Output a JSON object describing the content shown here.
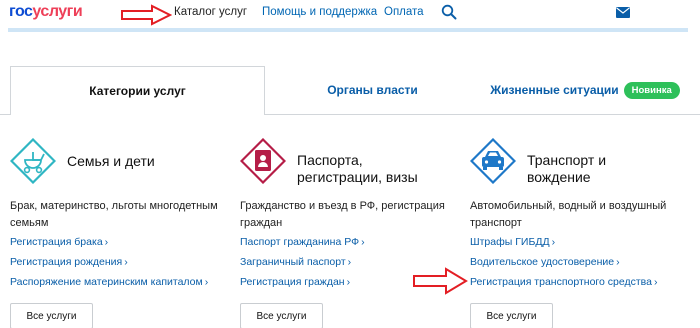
{
  "header": {
    "logo_part1": "гос",
    "logo_part2": "услуги",
    "nav": [
      {
        "label": "Каталог услуг"
      },
      {
        "label": "Помощь и поддержка"
      },
      {
        "label": "Оплата"
      }
    ],
    "icons": {
      "search": "search-icon",
      "mail": "mail-icon"
    }
  },
  "tabs": [
    {
      "label": "Категории услуг"
    },
    {
      "label": "Органы власти"
    },
    {
      "label": "Жизненные ситуации",
      "badge": "Новинка"
    }
  ],
  "categories": [
    {
      "title_line1": "Семья и дети",
      "title_line2": "",
      "description": "Брак, материнство, льготы многодетным семьям",
      "links": [
        "Регистрация брака",
        "Регистрация рождения",
        "Распоряжение материнским капиталом"
      ],
      "button": "Все услуги",
      "icon": "stroller-icon"
    },
    {
      "title_line1": "Паспорта,",
      "title_line2": "регистрации, визы",
      "description": "Гражданство и въезд в РФ, регистрация граждан",
      "links": [
        "Паспорт гражданина РФ",
        "Заграничный паспорт",
        "Регистрация граждан"
      ],
      "button": "Все услуги",
      "icon": "passport-icon"
    },
    {
      "title_line1": "Транспорт и",
      "title_line2": "вождение",
      "description": "Автомобильный, водный и воздушный транспорт",
      "links": [
        "Штрафы ГИБДД",
        "Водительское удостоверение",
        "Регистрация транспортного средства"
      ],
      "button": "Все услуги",
      "icon": "car-icon"
    }
  ],
  "colors": {
    "link": "#0a5ea8",
    "badge": "#2ec05a",
    "annotation_arrow": "#e31e24",
    "family_icon": "#2fb6c3",
    "passport_icon": "#b51d47",
    "transport_icon": "#1e78c8"
  }
}
